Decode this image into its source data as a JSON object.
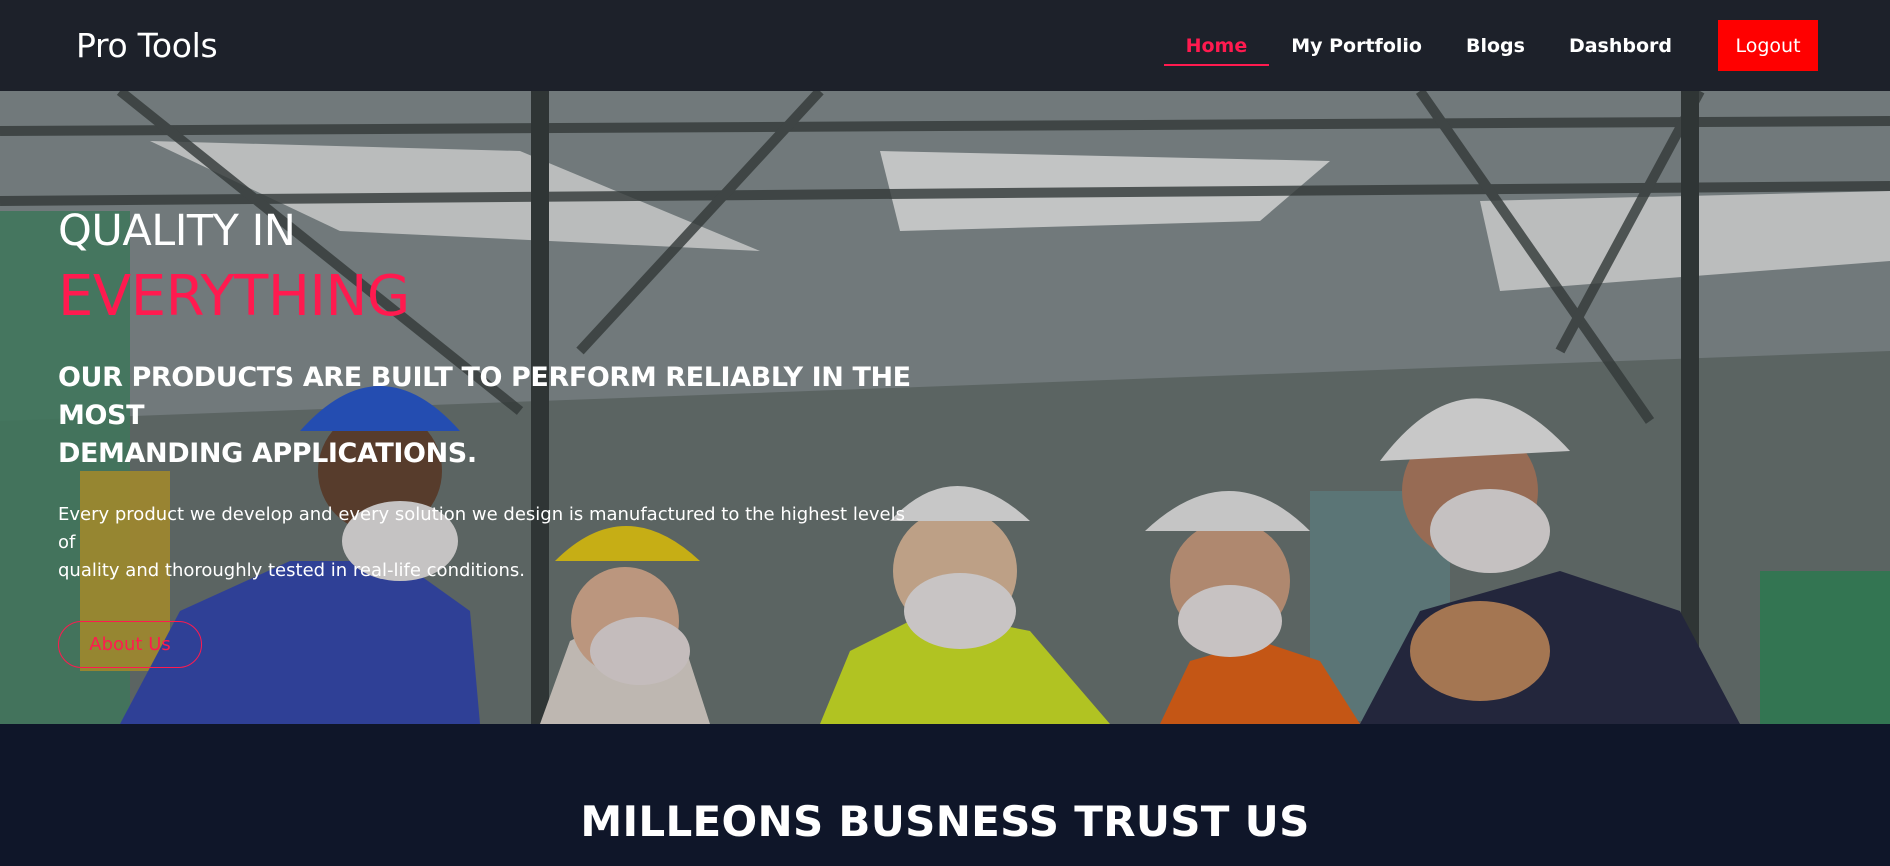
{
  "navbar": {
    "brand": "Pro Tools",
    "links": [
      {
        "label": "Home",
        "active": true
      },
      {
        "label": "My Portfolio",
        "active": false
      },
      {
        "label": "Blogs",
        "active": false
      },
      {
        "label": "Dashbord",
        "active": false
      }
    ],
    "logout_label": "Logout"
  },
  "hero": {
    "title_line1": "QUALITY IN",
    "title_line2": "EVERYTHING",
    "subtitle_line1": "OUR PRODUCTS ARE BUILT TO PERFORM RELIABLY IN THE MOST",
    "subtitle_line2": "DEMANDING APPLICATIONS.",
    "description_line1": "Every product we develop and every solution we design is manufactured to the highest levels of",
    "description_line2": "quality and thoroughly tested in real-life conditions.",
    "cta_label": "About Us"
  },
  "trust": {
    "title": "MILLEONS BUSNESS TRUST US"
  },
  "colors": {
    "accent": "#ff1a4f",
    "logout": "#ff0000",
    "navbar_bg": "#1d212a",
    "section_bg": "#0f1629"
  }
}
